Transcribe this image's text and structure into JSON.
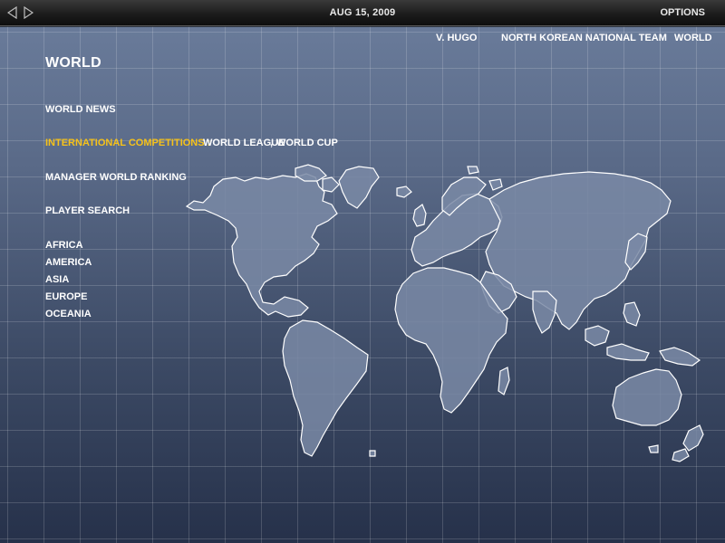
{
  "topbar": {
    "date": "AUG 15, 2009",
    "options_label": "OPTIONS",
    "back_icon": "triangle-left-icon",
    "forward_icon": "triangle-right-icon"
  },
  "header": {
    "manager": "V. HUGO",
    "team": "NORTH KOREAN NATIONAL TEAM",
    "section": "WORLD"
  },
  "page": {
    "title": "WORLD"
  },
  "menu": {
    "world_news": "WORLD NEWS",
    "international_label": "INTERNATIONAL COMPETITIONS :",
    "competitions": [
      "WORLD LEAGUE",
      "WORLD CUP"
    ],
    "competition_separator": ",",
    "manager_ranking": "MANAGER WORLD RANKING",
    "player_search": "PLAYER SEARCH",
    "regions": [
      "AFRICA",
      "AMERICA",
      "ASIA",
      "EUROPE",
      "OCEANIA"
    ]
  },
  "colors": {
    "highlight": "#f6c21a",
    "text": "#ffffff",
    "continent_fill": "#7a8aa6",
    "continent_stroke": "#ffffff"
  }
}
